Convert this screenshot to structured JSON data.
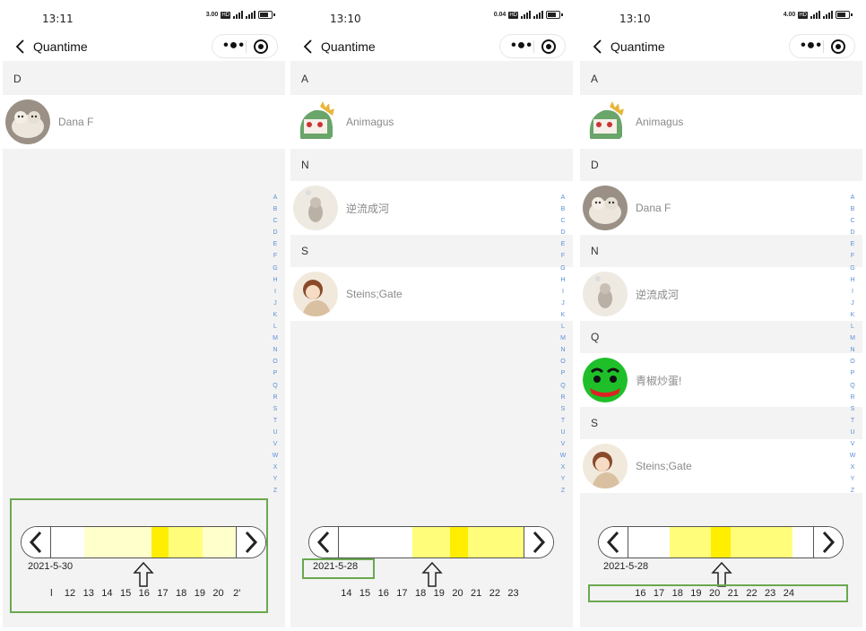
{
  "app": {
    "title": "Quantime"
  },
  "phones": [
    {
      "time": "13:11",
      "speed": "3.00",
      "speed_unit": "KB/S",
      "groups": [
        {
          "letter": "D",
          "contacts": [
            {
              "name": "Dana F",
              "avatar": "cat-photo"
            }
          ]
        }
      ],
      "timeline": {
        "date": "2021-5-30",
        "ticks": [
          "l",
          "12",
          "13",
          "14",
          "15",
          "16",
          "17",
          "18",
          "19",
          "20",
          "2'"
        ],
        "heat": [
          0,
          0,
          0.4,
          0.4,
          0.4,
          0.2,
          1,
          0.5,
          0.6,
          0.3,
          0.2
        ]
      }
    },
    {
      "time": "13:10",
      "speed": "0.04",
      "speed_unit": "KB/S",
      "groups": [
        {
          "letter": "A",
          "contacts": [
            {
              "name": "Animagus",
              "avatar": "dino-cartoon"
            }
          ]
        },
        {
          "letter": "N",
          "contacts": [
            {
              "name": "逆流成河",
              "avatar": "cat-sketch"
            }
          ]
        },
        {
          "letter": "S",
          "contacts": [
            {
              "name": "Steins;Gate",
              "avatar": "anime-girl"
            }
          ]
        }
      ],
      "timeline": {
        "date": "2021-5-28",
        "ticks": [
          "14",
          "15",
          "16",
          "17",
          "18",
          "19",
          "20",
          "21",
          "22",
          "23"
        ],
        "heat": [
          0,
          0,
          0,
          0,
          0.5,
          0.5,
          1,
          0.7,
          0.5,
          0.5
        ]
      }
    },
    {
      "time": "13:10",
      "speed": "4.00",
      "speed_unit": "KB/S",
      "groups": [
        {
          "letter": "A",
          "contacts": [
            {
              "name": "Animagus",
              "avatar": "dino-cartoon"
            }
          ]
        },
        {
          "letter": "D",
          "contacts": [
            {
              "name": "Dana F",
              "avatar": "cat-photo"
            }
          ]
        },
        {
          "letter": "N",
          "contacts": [
            {
              "name": "逆流成河",
              "avatar": "cat-sketch"
            }
          ]
        },
        {
          "letter": "Q",
          "contacts": [
            {
              "name": "青椒炒蛋!",
              "avatar": "green-face"
            }
          ]
        },
        {
          "letter": "S",
          "contacts": [
            {
              "name": "Steins;Gate",
              "avatar": "anime-girl"
            }
          ]
        }
      ],
      "timeline": {
        "date": "2021-5-28",
        "ticks": [
          "16",
          "17",
          "18",
          "19",
          "20",
          "21",
          "22",
          "23",
          "24"
        ],
        "heat": [
          0,
          0,
          0.5,
          0.5,
          1,
          0.7,
          0.5,
          0.5,
          0
        ]
      }
    }
  ],
  "az_index": [
    "A",
    "B",
    "C",
    "D",
    "E",
    "F",
    "G",
    "H",
    "I",
    "J",
    "K",
    "L",
    "M",
    "N",
    "O",
    "P",
    "Q",
    "R",
    "S",
    "T",
    "U",
    "V",
    "W",
    "X",
    "Y",
    "Z"
  ],
  "colors": {
    "heat_max": "#ffee00",
    "heat_low": "#fffd7a",
    "heat_faint": "#ffffcc",
    "highlight_box": "#6aa84f",
    "index_letter": "#5b8fd6"
  }
}
